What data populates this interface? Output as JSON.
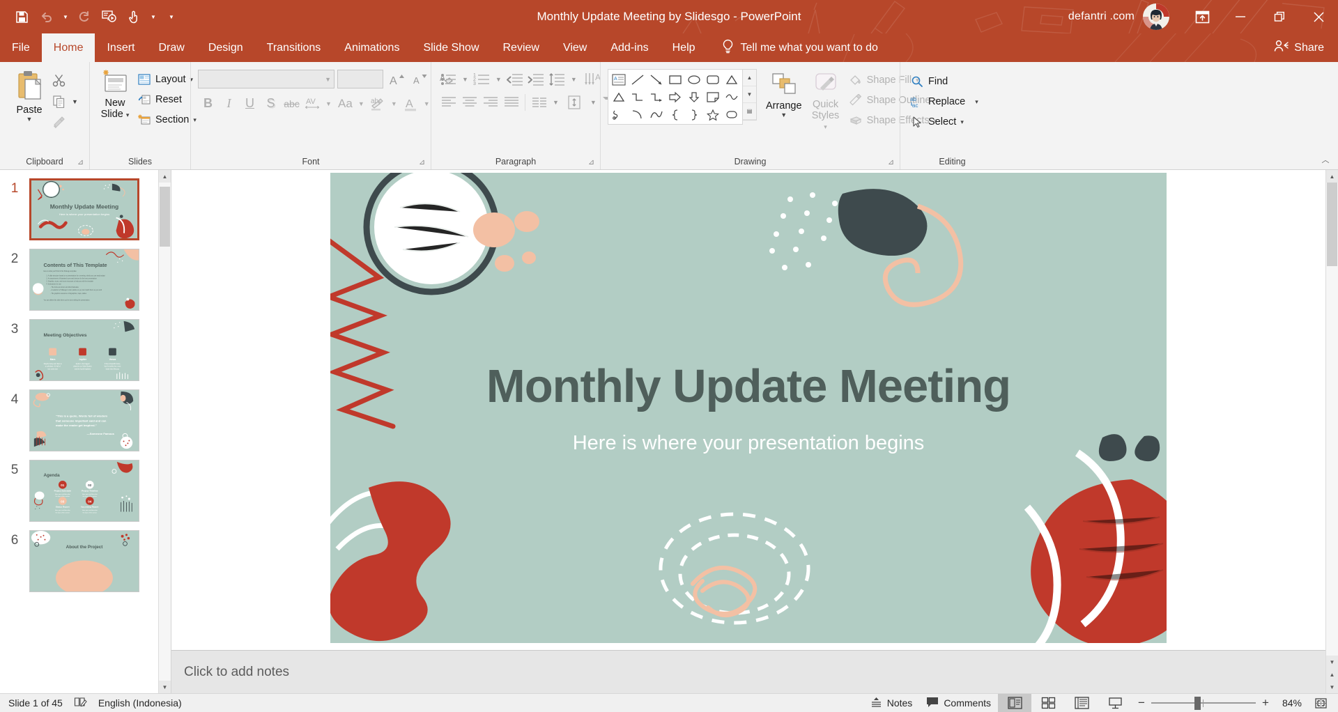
{
  "titlebar": {
    "document_title": "Monthly Update Meeting by Slidesgo",
    "separator": "-",
    "app_name": "PowerPoint",
    "account_name": "defantri .com",
    "qat": [
      {
        "name": "save",
        "label": "Save"
      },
      {
        "name": "undo",
        "label": "Undo"
      },
      {
        "name": "redo",
        "label": "Repeat"
      },
      {
        "name": "start-from-beginning",
        "label": "Start From Beginning"
      },
      {
        "name": "touch-mouse-mode",
        "label": "Touch/Mouse Mode"
      },
      {
        "name": "customize-qat",
        "label": "Customize Quick Access Toolbar"
      }
    ],
    "window_controls": [
      {
        "name": "ribbon-display-options",
        "label": "Ribbon Display Options"
      },
      {
        "name": "minimize",
        "label": "Minimize"
      },
      {
        "name": "restore",
        "label": "Restore Down"
      },
      {
        "name": "close",
        "label": "Close"
      }
    ]
  },
  "tabs": [
    {
      "label": "File",
      "active": false
    },
    {
      "label": "Home",
      "active": true
    },
    {
      "label": "Insert",
      "active": false
    },
    {
      "label": "Draw",
      "active": false
    },
    {
      "label": "Design",
      "active": false
    },
    {
      "label": "Transitions",
      "active": false
    },
    {
      "label": "Animations",
      "active": false
    },
    {
      "label": "Slide Show",
      "active": false
    },
    {
      "label": "Review",
      "active": false
    },
    {
      "label": "View",
      "active": false
    },
    {
      "label": "Add-ins",
      "active": false
    },
    {
      "label": "Help",
      "active": false
    }
  ],
  "tell_me": {
    "label": "Tell me what you want to do"
  },
  "share": {
    "label": "Share"
  },
  "ribbon": {
    "groups": [
      {
        "name": "clipboard",
        "label": "Clipboard"
      },
      {
        "name": "slides",
        "label": "Slides"
      },
      {
        "name": "font",
        "label": "Font"
      },
      {
        "name": "paragraph",
        "label": "Paragraph"
      },
      {
        "name": "drawing",
        "label": "Drawing"
      },
      {
        "name": "editing",
        "label": "Editing"
      }
    ],
    "clipboard": {
      "paste_label": "Paste",
      "cut_label": "Cut",
      "copy_label": "Copy",
      "format_painter_label": "Format Painter"
    },
    "slides": {
      "new_slide_line1": "New",
      "new_slide_line2": "Slide",
      "layout_label": "Layout",
      "reset_label": "Reset",
      "section_label": "Section"
    },
    "font": {
      "font_name_value": "",
      "font_size_value": "",
      "bold": "B",
      "italic": "I",
      "underline": "U",
      "shadow": "S",
      "strikethrough": "abc",
      "char_spacing": "AV",
      "change_case": "Aa"
    },
    "drawing": {
      "arrange_label": "Arrange",
      "quick_styles_line1": "Quick",
      "quick_styles_line2": "Styles",
      "shape_fill_label": "Shape Fill",
      "shape_outline_label": "Shape Outline",
      "shape_effects_label": "Shape Effects"
    },
    "editing": {
      "find_label": "Find",
      "replace_label": "Replace",
      "select_label": "Select"
    },
    "collapse_label": "Collapse the Ribbon"
  },
  "thumbnails": [
    {
      "number": "1",
      "title": "Monthly Update Meeting",
      "subtitle": "Here is where your presentation begins",
      "selected": true,
      "kind": "title"
    },
    {
      "number": "2",
      "title": "Contents of This Template",
      "selected": false,
      "kind": "contents"
    },
    {
      "number": "3",
      "title": "Meeting Objectives",
      "selected": false,
      "kind": "objectives"
    },
    {
      "number": "4",
      "title": "\"This is a quote, Words full of wisdom that someone important said and can make the reader get inspired.\"",
      "attribution": "—Someone Famous",
      "selected": false,
      "kind": "quote"
    },
    {
      "number": "5",
      "title": "Agenda",
      "selected": false,
      "kind": "agenda"
    },
    {
      "number": "6",
      "title": "About the Project",
      "selected": false,
      "kind": "about"
    }
  ],
  "agenda_items": [
    {
      "num": "01",
      "label": "Project Schedule",
      "desc": "Here you could describe the topic of the section"
    },
    {
      "num": "02",
      "label": "Project Timeline",
      "desc": "Here you could describe the topic of the section"
    },
    {
      "num": "03",
      "label": "Status Report",
      "desc": "Here you could describe the topic of the section"
    },
    {
      "num": "04",
      "label": "Upcoming Report",
      "desc": "Here you could describe the topic of the section"
    }
  ],
  "slide": {
    "title": "Monthly Update Meeting",
    "subtitle": "Here is where your presentation begins",
    "background_color": "#b2cdc4",
    "title_color": "#4f5f5b",
    "subtitle_color": "#ffffff"
  },
  "notes": {
    "placeholder": "Click to add notes"
  },
  "statusbar": {
    "slide_counter": "Slide 1 of 45",
    "language": "English (Indonesia)",
    "notes_label": "Notes",
    "comments_label": "Comments",
    "zoom_percent": "84%",
    "views": [
      {
        "name": "normal-view",
        "label": "Normal",
        "active": true
      },
      {
        "name": "slide-sorter-view",
        "label": "Slide Sorter",
        "active": false
      },
      {
        "name": "reading-view",
        "label": "Reading View",
        "active": false
      },
      {
        "name": "slide-show-view",
        "label": "Slide Show",
        "active": false
      }
    ],
    "fit_label": "Fit slide to current window"
  },
  "colors": {
    "accent": "#b7472a",
    "ribbon_bg": "#f3f3f3",
    "slide_green": "#b2cdc4",
    "slide_dark": "#4f5f5b",
    "slide_red": "#c0392b",
    "slide_peach": "#f3c0a4"
  }
}
